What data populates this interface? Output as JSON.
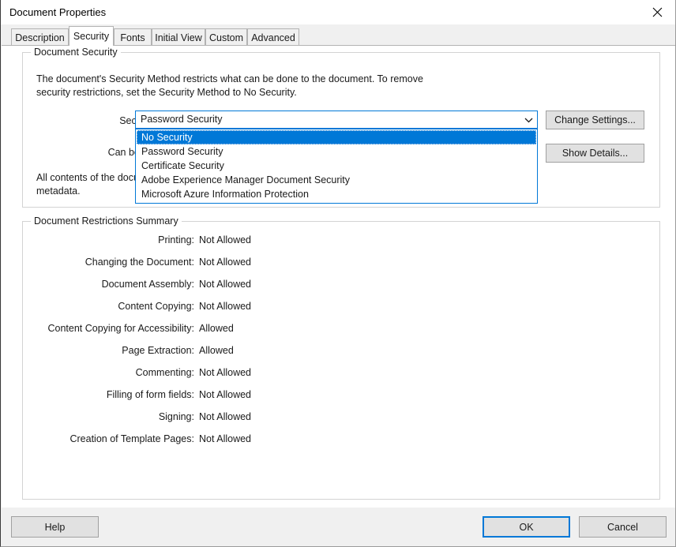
{
  "window": {
    "title": "Document Properties",
    "close_icon": "close-icon"
  },
  "tabs": [
    {
      "label": "Description",
      "selected": false
    },
    {
      "label": "Security",
      "selected": true
    },
    {
      "label": "Fonts",
      "selected": false
    },
    {
      "label": "Initial View",
      "selected": false
    },
    {
      "label": "Custom",
      "selected": false
    },
    {
      "label": "Advanced",
      "selected": false
    }
  ],
  "document_security": {
    "group_title": "Document Security",
    "description": "The document's Security Method restricts what can be done to the document. To remove\nsecurity restrictions, set the Security Method to No Security.",
    "security_method_label": "Security Method:",
    "security_method_value": "Password Security",
    "can_be_opened_by_label": "Can be Opened by:",
    "contents_note": "All contents of the docu                    ...\nmetadata.",
    "dropdown_arrow_icon": "chevron-down-icon",
    "options": [
      {
        "label": "No Security",
        "selected": true
      },
      {
        "label": "Password Security",
        "selected": false
      },
      {
        "label": "Certificate Security",
        "selected": false
      },
      {
        "label": "Adobe Experience Manager Document Security",
        "selected": false
      },
      {
        "label": "Microsoft Azure Information Protection",
        "selected": false
      }
    ],
    "change_settings_label": "Change Settings...",
    "show_details_label": "Show Details..."
  },
  "restrictions": {
    "group_title": "Document Restrictions Summary",
    "rows": [
      {
        "label": "Printing:",
        "value": "Not Allowed"
      },
      {
        "label": "Changing the Document:",
        "value": "Not Allowed"
      },
      {
        "label": "Document Assembly:",
        "value": "Not Allowed"
      },
      {
        "label": "Content Copying:",
        "value": "Not Allowed"
      },
      {
        "label": "Content Copying for Accessibility:",
        "value": "Allowed"
      },
      {
        "label": "Page Extraction:",
        "value": "Allowed"
      },
      {
        "label": "Commenting:",
        "value": "Not Allowed"
      },
      {
        "label": "Filling of form fields:",
        "value": "Not Allowed"
      },
      {
        "label": "Signing:",
        "value": "Not Allowed"
      },
      {
        "label": "Creation of Template Pages:",
        "value": "Not Allowed"
      }
    ]
  },
  "footer": {
    "help_label": "Help",
    "ok_label": "OK",
    "cancel_label": "Cancel"
  },
  "colors": {
    "accent": "#0078d7",
    "dialog_face": "#f0f0f0",
    "button_face": "#e1e1e1",
    "content_bg": "#ffffff",
    "border": "#d3d3d3"
  }
}
